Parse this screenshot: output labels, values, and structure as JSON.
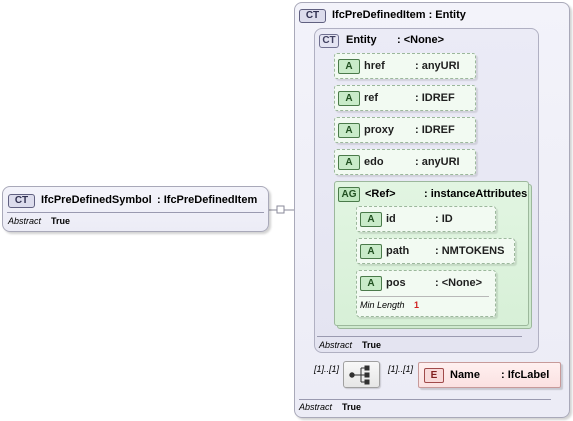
{
  "root": {
    "badge": "CT",
    "name": "IfcPreDefinedSymbol",
    "type": ": IfcPreDefinedItem",
    "abstract_label": "Abstract",
    "abstract_value": "True"
  },
  "parent": {
    "badge": "CT",
    "title": "IfcPreDefinedItem : Entity",
    "abstract_label": "Abstract",
    "abstract_value": "True"
  },
  "entity": {
    "badge": "CT",
    "name": "Entity",
    "type": ": <None>",
    "abstract_label": "Abstract",
    "abstract_value": "True",
    "attributes": [
      {
        "badge": "A",
        "name": "href",
        "type": ": anyURI"
      },
      {
        "badge": "A",
        "name": "ref",
        "type": ": IDREF"
      },
      {
        "badge": "A",
        "name": "proxy",
        "type": ": IDREF"
      },
      {
        "badge": "A",
        "name": "edo",
        "type": ": anyURI"
      }
    ],
    "group": {
      "badge": "AG",
      "name": "<Ref>",
      "type": ": instanceAttributes",
      "attributes": [
        {
          "badge": "A",
          "name": "id",
          "type": ": ID"
        },
        {
          "badge": "A",
          "name": "path",
          "type": ": NMTOKENS"
        },
        {
          "badge": "A",
          "name": "pos",
          "type": ": <None>",
          "facet_label": "Min Length",
          "facet_value": "1"
        }
      ]
    }
  },
  "sequence": {
    "left_card": "[1]..[1]",
    "right_card": "[1]..[1]"
  },
  "name_element": {
    "badge": "E",
    "name": "Name",
    "type": ": IfcLabel"
  },
  "colors": {
    "ct_border": "#a9a9b9",
    "ct_fill": "#ececf6",
    "attr_border": "#9cb89c",
    "group_fill": "#d7f0d7",
    "element_fill": "#fde6e6",
    "facet_value": "#d02020"
  }
}
